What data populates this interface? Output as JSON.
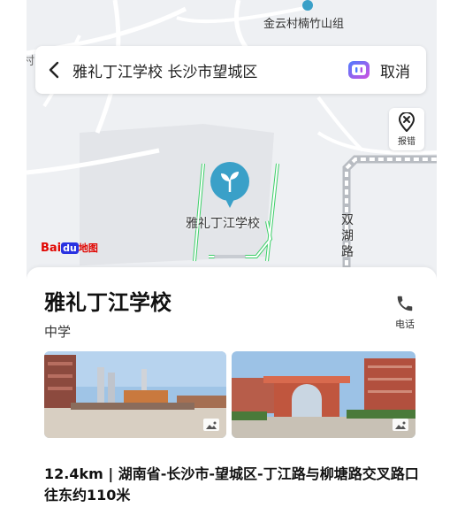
{
  "map": {
    "labels": {
      "village": "金云村楠竹山组",
      "edge_fragment": "村",
      "poi": "雅礼丁江学校",
      "road": "双湖路"
    },
    "logo": {
      "part1": "Bai",
      "part2": "du",
      "part3": "地图"
    },
    "colors": {
      "land": "#eef0f3",
      "campus": "#e4e6ea",
      "road": "#ffffff",
      "boundary": "#3ccf68",
      "pin": "#3aa0c8",
      "highway": "#b8bcc2"
    }
  },
  "search": {
    "back_icon": "chevron-left-icon",
    "query": "雅礼丁江学校 长沙市望城区",
    "ai_icon": "ai-assistant-icon",
    "cancel_label": "取消"
  },
  "report": {
    "icon": "map-pin-error-icon",
    "label": "报错"
  },
  "place": {
    "name": "雅礼丁江学校",
    "category": "中学",
    "phone_icon": "phone-icon",
    "phone_label": "电话",
    "photos": [
      {
        "icon": "image-icon"
      },
      {
        "icon": "image-icon"
      }
    ],
    "address": "12.4km | 湖南省-长沙市-望城区-丁江路与柳塘路交叉路口往东约110米"
  }
}
